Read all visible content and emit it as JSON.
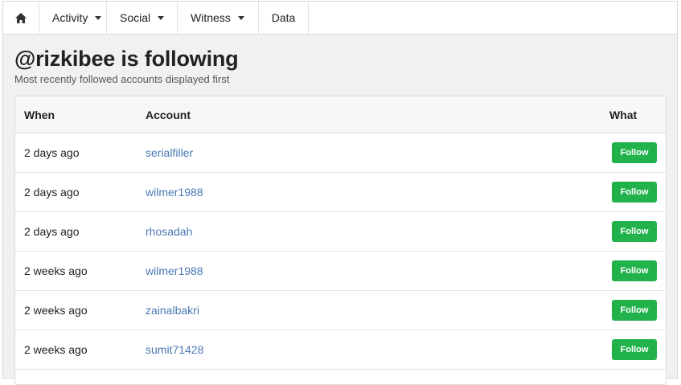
{
  "nav": {
    "home_icon": "home-icon",
    "items": [
      {
        "label": "Activity",
        "dropdown": true
      },
      {
        "label": "Social",
        "dropdown": true
      },
      {
        "label": "Witness",
        "dropdown": true
      },
      {
        "label": "Data",
        "dropdown": false
      }
    ]
  },
  "page": {
    "title": "@rizkibee is following",
    "subtitle": "Most recently followed accounts displayed first"
  },
  "table": {
    "headers": {
      "when": "When",
      "account": "Account",
      "what": "What"
    },
    "rows": [
      {
        "when": "2 days ago",
        "account": "serialfiller",
        "what": "Follow"
      },
      {
        "when": "2 days ago",
        "account": "wilmer1988",
        "what": "Follow"
      },
      {
        "when": "2 days ago",
        "account": "rhosadah",
        "what": "Follow"
      },
      {
        "when": "2 weeks ago",
        "account": "wilmer1988",
        "what": "Follow"
      },
      {
        "when": "2 weeks ago",
        "account": "zainalbakri",
        "what": "Follow"
      },
      {
        "when": "2 weeks ago",
        "account": "sumit71428",
        "what": "Follow"
      }
    ]
  },
  "colors": {
    "follow_button": "#22b24c",
    "link": "#4a78b4"
  }
}
